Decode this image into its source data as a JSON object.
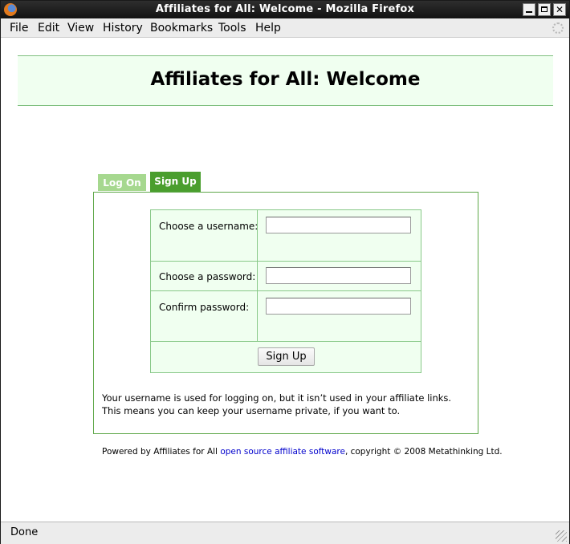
{
  "window": {
    "title": "Affiliates for All: Welcome - Mozilla Firefox"
  },
  "menu": [
    {
      "label": "File"
    },
    {
      "label": "Edit"
    },
    {
      "label": "View"
    },
    {
      "label": "History"
    },
    {
      "label": "Bookmarks"
    },
    {
      "label": "Tools"
    },
    {
      "label": "Help"
    }
  ],
  "page": {
    "title": "Affiliates for All: Welcome",
    "tabs": {
      "logon": "Log On",
      "signup": "Sign Up"
    },
    "form": {
      "username_label": "Choose a username:",
      "password_label": "Choose a password:",
      "confirm_label": "Confirm password:",
      "username_value": "",
      "password_value": "",
      "confirm_value": "",
      "submit_label": "Sign Up"
    },
    "help_text": "Your username is used for logging on, but it isn’t used in your affiliate links. This means you can keep your username private, if you want to.",
    "footer": {
      "prefix": "Powered by Affiliates for All ",
      "link_text": "open source affiliate software",
      "suffix": ", copyright © 2008 Metathinking Ltd."
    }
  },
  "status": {
    "text": "Done"
  },
  "icons": {
    "app": "firefox-icon",
    "minimize": "minimize-icon",
    "maximize": "maximize-icon",
    "close": "close-icon",
    "throbber": "throbber-icon",
    "resize": "resize-grip-icon"
  },
  "colors": {
    "header_bg": "#f0fff0",
    "accent_green": "#4a9e2e",
    "tab_inactive": "#a6d88f",
    "link": "#0000cc"
  }
}
